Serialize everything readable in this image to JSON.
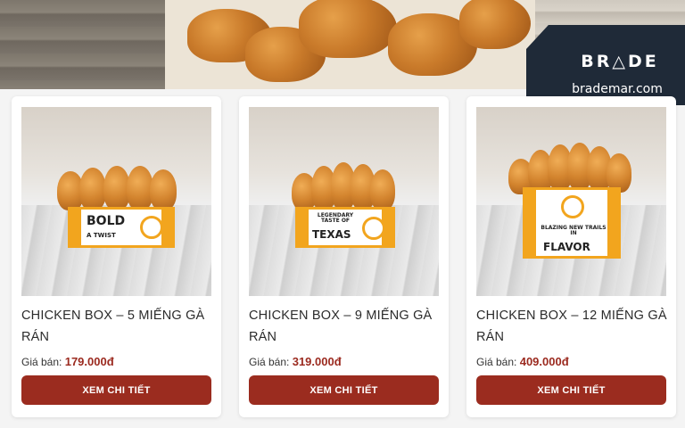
{
  "brand": {
    "logo_text": "BR△DE",
    "url_text": "brademar.com"
  },
  "products": [
    {
      "title": "CHICKEN BOX – 5 MIẾNG GÀ RÁN",
      "price_label": "Giá bán:",
      "price": "179.000đ",
      "button_label": "XEM CHI TIẾT",
      "box_text": "BOLD",
      "box_subtext": "A TWIST"
    },
    {
      "title": "CHICKEN BOX – 9 MIẾNG GÀ RÁN",
      "price_label": "Giá bán:",
      "price": "319.000đ",
      "button_label": "XEM CHI TIẾT",
      "box_text": "TEXAS",
      "box_subtext": "LEGENDARY TASTE OF"
    },
    {
      "title": "CHICKEN BOX – 12 MIẾNG GÀ RÁN",
      "price_label": "Giá bán:",
      "price": "409.000đ",
      "button_label": "XEM CHI TIẾT",
      "box_text": "FLAVOR",
      "box_subtext": "BLAZING NEW TRAILS IN"
    }
  ],
  "colors": {
    "accent_button": "#9b2c1f",
    "price": "#9b2a1f",
    "box_orange": "#f2a51e",
    "brand_bg": "#1f2a38"
  }
}
